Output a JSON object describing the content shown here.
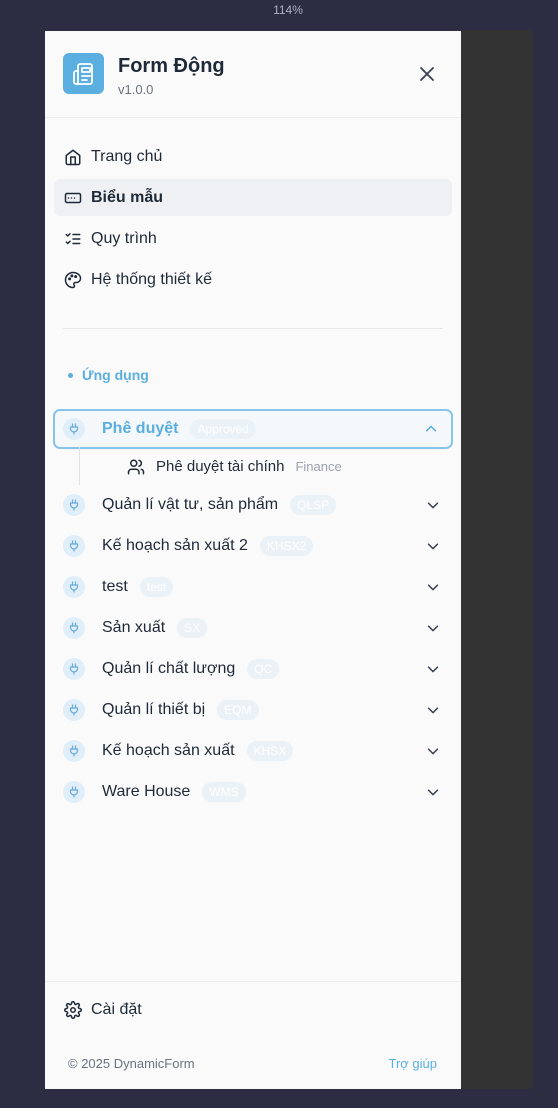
{
  "zoom_label": "114%",
  "brand": {
    "title": "Form Động",
    "version": "v1.0.0"
  },
  "nav": [
    {
      "label": "Trang chủ",
      "icon": "home-icon",
      "active": false
    },
    {
      "label": "Biểu mẫu",
      "icon": "form-icon",
      "active": true
    },
    {
      "label": "Quy trình",
      "icon": "checklist-icon",
      "active": false
    },
    {
      "label": "Hệ thống thiết kế",
      "icon": "palette-icon",
      "active": false
    }
  ],
  "section_label": "Ứng dụng",
  "apps": [
    {
      "name": "Phê duyệt",
      "code": "Approved",
      "open": true,
      "children": [
        {
          "name": "Phê duyệt tài chính",
          "code": "Finance"
        }
      ]
    },
    {
      "name": "Quản lí vật tư, sản phẩm",
      "code": "QLSP"
    },
    {
      "name": "Kế hoạch sản xuất 2",
      "code": "KHSX2"
    },
    {
      "name": "test",
      "code": "test"
    },
    {
      "name": "Sản xuất",
      "code": "SX"
    },
    {
      "name": "Quản lí chất lượng",
      "code": "QC"
    },
    {
      "name": "Quản lí thiết bị",
      "code": "EQM"
    },
    {
      "name": "Kế hoạch sản xuất",
      "code": "KHSX"
    },
    {
      "name": "Ware House",
      "code": "WMS"
    }
  ],
  "footer": {
    "settings_label": "Cài đặt",
    "copyright": "© 2025 DynamicForm",
    "help_label": "Trợ giúp"
  },
  "colors": {
    "accent": "#5aaee0",
    "backdrop": "#2c2c42",
    "drawer": "#fafafa"
  }
}
